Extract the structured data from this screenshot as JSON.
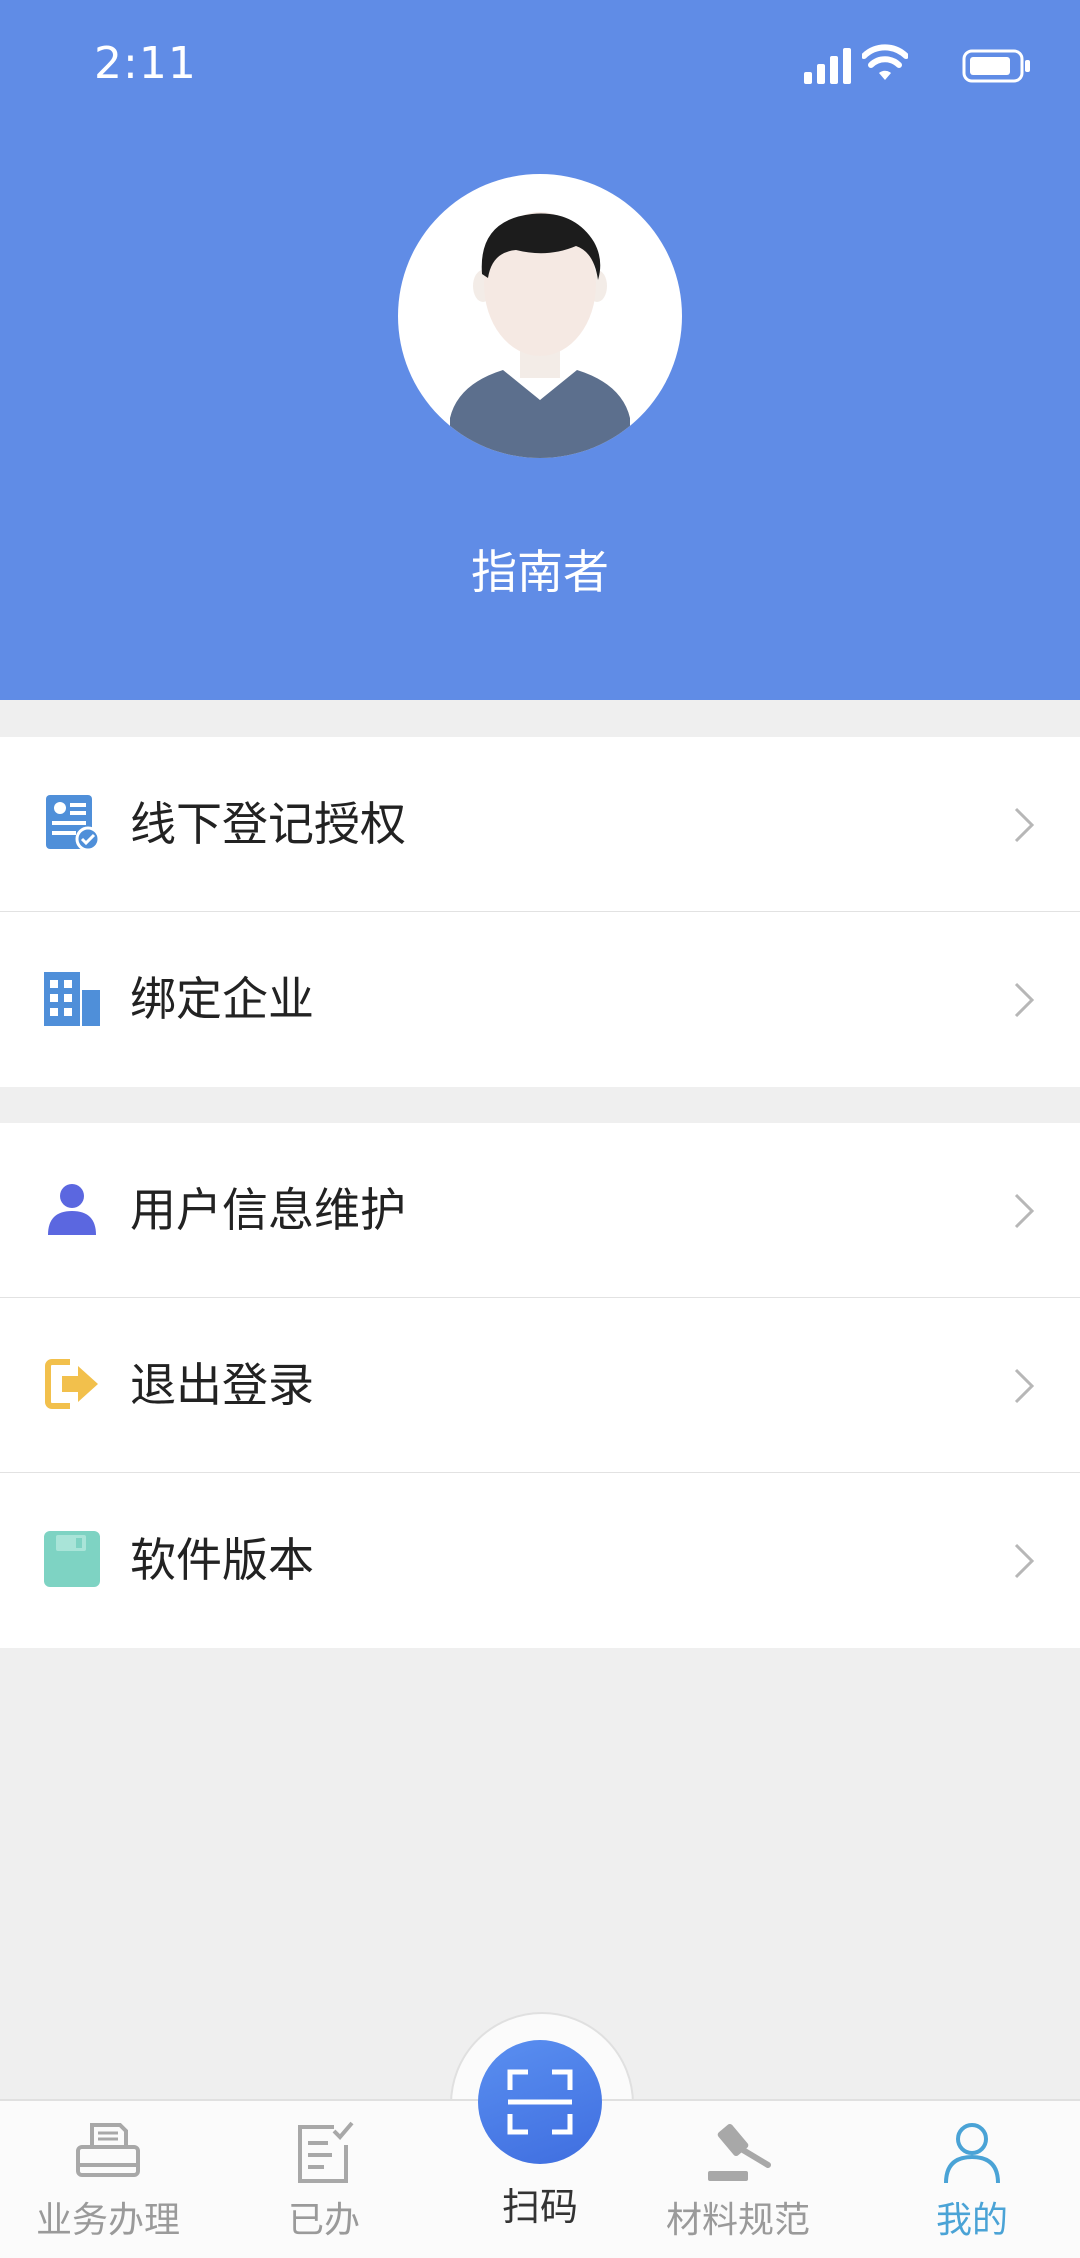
{
  "status_bar": {
    "time": "2:11"
  },
  "profile": {
    "name": "指南者"
  },
  "menu_groups": [
    {
      "items": [
        {
          "label": "线下登记授权",
          "icon": "certificate-icon"
        },
        {
          "label": "绑定企业",
          "icon": "building-icon"
        }
      ]
    },
    {
      "items": [
        {
          "label": "用户信息维护",
          "icon": "user-icon"
        },
        {
          "label": "退出登录",
          "icon": "logout-icon"
        },
        {
          "label": "软件版本",
          "icon": "save-disk-icon"
        }
      ]
    }
  ],
  "tabbar": {
    "tabs": [
      {
        "label": "业务办理",
        "icon": "printer-icon"
      },
      {
        "label": "已办",
        "icon": "done-list-icon"
      },
      {
        "label": "扫码",
        "icon": "scan-icon"
      },
      {
        "label": "材料规范",
        "icon": "gavel-icon"
      },
      {
        "label": "我的",
        "icon": "person-icon"
      }
    ],
    "active": "我的"
  },
  "colors": {
    "header": "#608ce6",
    "active_tab": "#4aa3d6",
    "inactive_tab": "#9a9a9a",
    "logout": "#f2c04c",
    "building": "#4f8fd9",
    "user": "#5b67e0",
    "disk": "#7ed3c3"
  }
}
